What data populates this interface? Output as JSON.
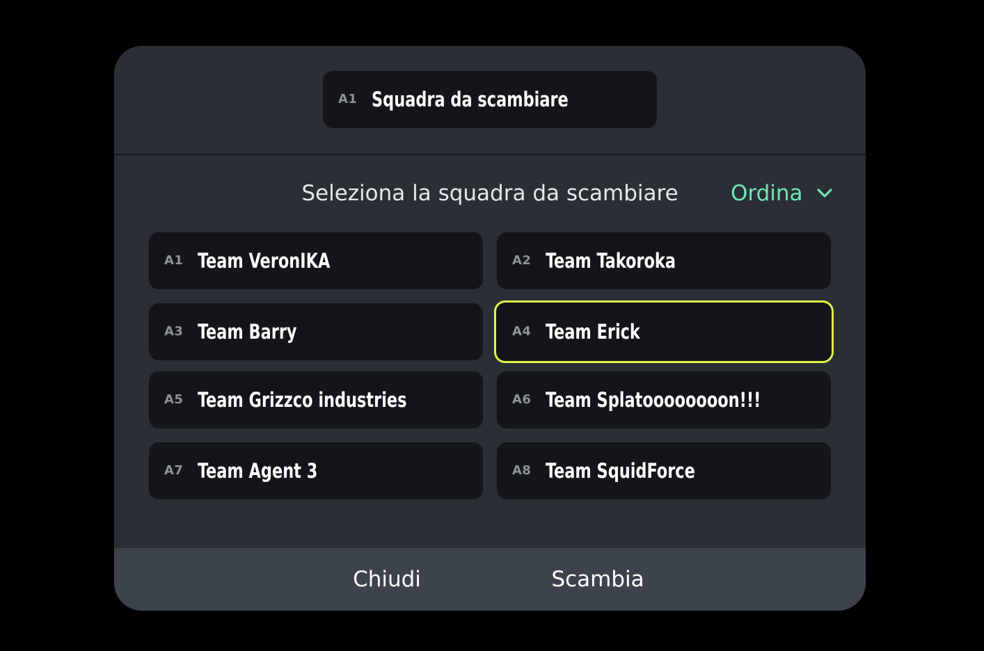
{
  "header": {
    "current_team": {
      "code": "A1",
      "name": "Squadra da scambiare"
    }
  },
  "prompt": "Seleziona la squadra da scambiare",
  "sort": {
    "label": "Ordina",
    "icon": "chevron-down-icon",
    "color": "#6ee6b5"
  },
  "teams": [
    {
      "code": "A1",
      "name": "Team VeronIKA",
      "selected": false
    },
    {
      "code": "A2",
      "name": "Team Takoroka",
      "selected": false
    },
    {
      "code": "A3",
      "name": "Team Barry",
      "selected": false
    },
    {
      "code": "A4",
      "name": "Team Erick",
      "selected": true
    },
    {
      "code": "A5",
      "name": "Team Grizzco industries",
      "selected": false
    },
    {
      "code": "A6",
      "name": "Team Splatoooooooon!!!",
      "selected": false
    },
    {
      "code": "A7",
      "name": "Team Agent 3",
      "selected": false
    },
    {
      "code": "A8",
      "name": "Team SquidForce",
      "selected": false
    }
  ],
  "footer": {
    "close_label": "Chiudi",
    "swap_label": "Scambia"
  },
  "colors": {
    "selection_border": "#e4f548",
    "accent": "#6ee6b5"
  }
}
